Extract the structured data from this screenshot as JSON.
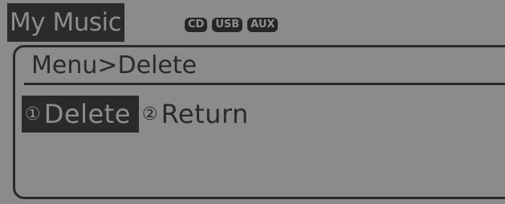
{
  "header": {
    "title": "My Music",
    "sources": [
      "CD",
      "USB",
      "AUX"
    ]
  },
  "breadcrumb": "Menu>Delete",
  "menu": {
    "options": [
      {
        "number": "①",
        "label": "Delete",
        "selected": true
      },
      {
        "number": "②",
        "label": "Return",
        "selected": false
      }
    ]
  },
  "colors": {
    "background": "#8b8b8b",
    "foreground": "#2a2a2a",
    "highlight_text": "#8e8e8e"
  }
}
